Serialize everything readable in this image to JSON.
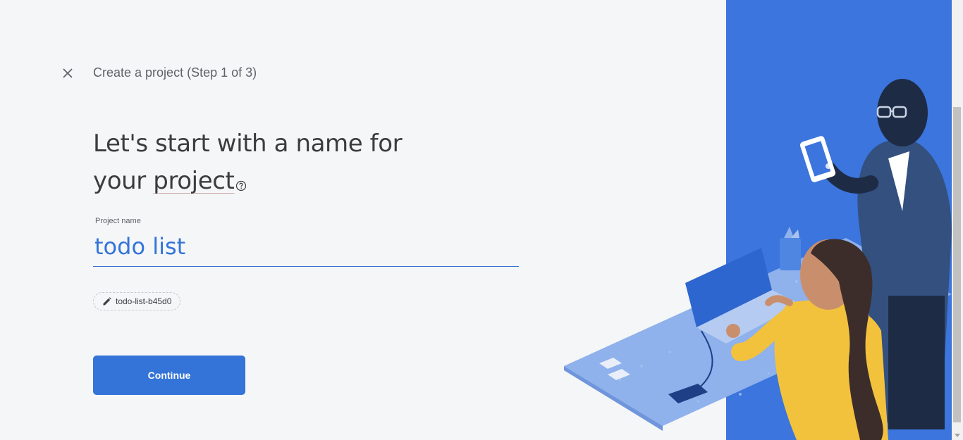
{
  "header": {
    "close_icon": "close-icon",
    "step_title": "Create a project (Step 1 of 3)"
  },
  "main": {
    "headline_part1": "Let's start with a name for",
    "headline_part2": "your ",
    "headline_underlined": "project",
    "help_icon": "help-circle-icon",
    "project_name_label": "Project name",
    "project_name_value": "todo list",
    "project_id": "todo-list-b45d0",
    "edit_icon": "pencil-icon",
    "continue_label": "Continue"
  },
  "colors": {
    "accent": "#3474d8",
    "illustration_blue": "#3b75dd",
    "background": "#f5f6f8"
  }
}
